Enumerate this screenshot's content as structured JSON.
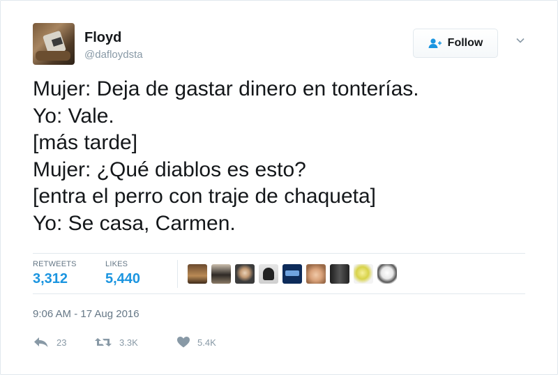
{
  "user": {
    "name": "Floyd",
    "handle": "@dafloydsta"
  },
  "follow": {
    "label": "Follow"
  },
  "tweet": {
    "lines": [
      "Mujer: Deja de gastar dinero en tonterías.",
      "Yo: Vale.",
      "[más tarde]",
      "Mujer: ¿Qué diablos es esto?",
      "[entra el perro con traje de chaqueta]",
      "Yo: Se casa, Carmen."
    ]
  },
  "stats": {
    "retweets_label": "RETWEETS",
    "retweets_value": "3,312",
    "likes_label": "LIKES",
    "likes_value": "5,440"
  },
  "timestamp": "9:06 AM - 17 Aug 2016",
  "actions": {
    "reply_count": "23",
    "retweet_count": "3.3K",
    "like_count": "5.4K"
  },
  "colors": {
    "link_blue": "#1b95e0",
    "muted_text": "#657786",
    "border": "#e1e8ed"
  }
}
